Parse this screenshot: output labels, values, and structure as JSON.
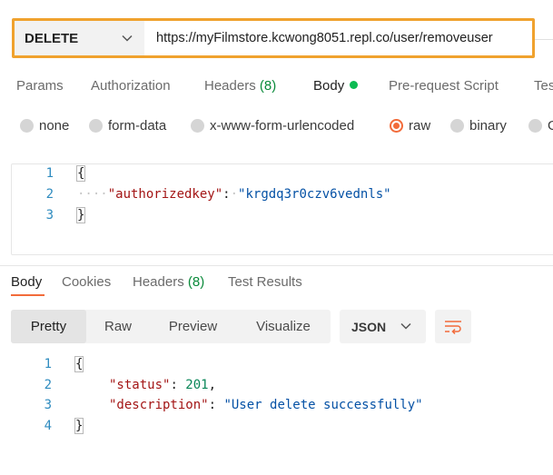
{
  "request": {
    "method": "DELETE",
    "url": "https://myFilmstore.kcwong8051.repl.co/user/removeuser"
  },
  "request_tabs": {
    "params": "Params",
    "authorization": "Authorization",
    "headers": "Headers",
    "headers_count": "(8)",
    "body": "Body",
    "pre_request": "Pre-request Script",
    "tests": "Tes"
  },
  "body_modes": {
    "none": "none",
    "form_data": "form-data",
    "urlencoded": "x-www-form-urlencoded",
    "raw": "raw",
    "binary": "binary",
    "graphql": "G"
  },
  "request_body": {
    "line_numbers": [
      "1",
      "2",
      "3"
    ],
    "open_brace": "{",
    "close_brace": "}",
    "key": "\"authorizedkey\"",
    "colon": ":",
    "value": "\"krgdq3r0czv6vednls\""
  },
  "response_tabs": {
    "body": "Body",
    "cookies": "Cookies",
    "headers": "Headers",
    "headers_count": "(8)",
    "test_results": "Test Results"
  },
  "response_view": {
    "pretty": "Pretty",
    "raw": "Raw",
    "preview": "Preview",
    "visualize": "Visualize",
    "format": "JSON"
  },
  "response_body": {
    "line_numbers": [
      "1",
      "2",
      "3",
      "4"
    ],
    "open_brace": "{",
    "close_brace": "}",
    "status_key": "\"status\"",
    "status_value": "201",
    "description_key": "\"description\"",
    "description_value": "\"User delete successfully\""
  },
  "colors": {
    "accent_orange": "#f26b3a",
    "highlight_border": "#f0a22e",
    "active_dot": "#0cbb52"
  }
}
